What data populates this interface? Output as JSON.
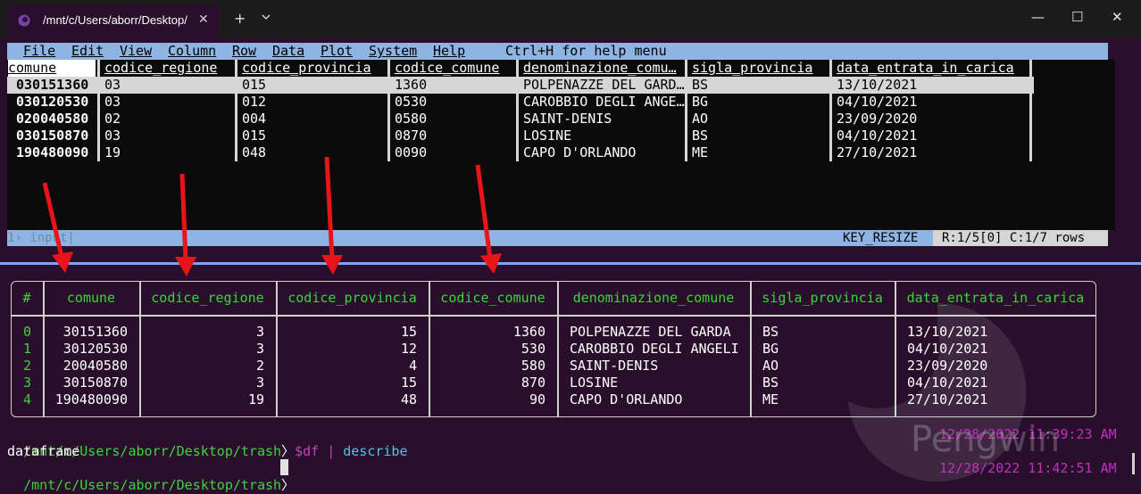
{
  "window": {
    "tab_title": "/mnt/c/Users/aborr/Desktop/",
    "tab_close": "✕",
    "new_tab": "+",
    "minimize": "—",
    "maximize": "☐",
    "close": "✕"
  },
  "tui": {
    "menu": [
      "File",
      "Edit",
      "View",
      "Column",
      "Row",
      "Data",
      "Plot",
      "System",
      "Help"
    ],
    "help_hint": "Ctrl+H for help menu",
    "headers": [
      "comune",
      "codice_regione",
      "codice_provincia",
      "codice_comune",
      "denominazione_comu…",
      "sigla_provincia",
      "data_entrata_in_carica"
    ],
    "rows": [
      [
        "030151360",
        "03",
        "015",
        "1360",
        "POLPENAZZE DEL GARD…",
        "BS",
        "13/10/2021"
      ],
      [
        "030120530",
        "03",
        "012",
        "0530",
        "CAROBBIO DEGLI ANGE…",
        "BG",
        "04/10/2021"
      ],
      [
        "020040580",
        "02",
        "004",
        "0580",
        "SAINT-DENIS",
        "AO",
        "23/09/2020"
      ],
      [
        "030150870",
        "03",
        "015",
        "0870",
        "LOSINE",
        "BS",
        "04/10/2021"
      ],
      [
        "190480090",
        "19",
        "048",
        "0090",
        "CAPO D'ORLANDO",
        "ME",
        "27/10/2021"
      ]
    ],
    "status_prompt": "1› input|",
    "status_key": "KEY_RESIZE",
    "status_pos": "R:1/5[0] C:1/7 rows"
  },
  "nu_table": {
    "headers": [
      "#",
      "comune",
      "codice_regione",
      "codice_provincia",
      "codice_comune",
      "denominazione_comune",
      "sigla_provincia",
      "data_entrata_in_carica"
    ],
    "rows": [
      [
        "0",
        "30151360",
        "3",
        "15",
        "1360",
        "POLPENAZZE DEL GARDA",
        "BS",
        "13/10/2021"
      ],
      [
        "1",
        "30120530",
        "3",
        "12",
        "530",
        "CAROBBIO DEGLI ANGELI",
        "BG",
        "04/10/2021"
      ],
      [
        "2",
        "20040580",
        "2",
        "4",
        "580",
        "SAINT-DENIS",
        "AO",
        "23/09/2020"
      ],
      [
        "3",
        "30150870",
        "3",
        "15",
        "870",
        "LOSINE",
        "BS",
        "04/10/2021"
      ],
      [
        "4",
        "190480090",
        "19",
        "48",
        "90",
        "CAPO D'ORLANDO",
        "ME",
        "27/10/2021"
      ]
    ]
  },
  "shell": {
    "path1": "/mnt/c/Users/aborr/Desktop/trash",
    "chevron": "〉",
    "cmd_var": "$df",
    "pipe": "|",
    "cmd": "describe",
    "output": "dataframe",
    "path2": "/mnt/c/Users/aborr/Desktop/trash",
    "ts1": "12/28/2022 11:39:23 AM",
    "ts2": "12/28/2022 11:42:51 AM"
  },
  "watermark": "Pengwin",
  "colors": {
    "accent": "#8db4e2",
    "background": "#2a0f2d",
    "green": "#3fd13f",
    "arrow": "#e8141a",
    "timestamp": "#c030c0"
  }
}
